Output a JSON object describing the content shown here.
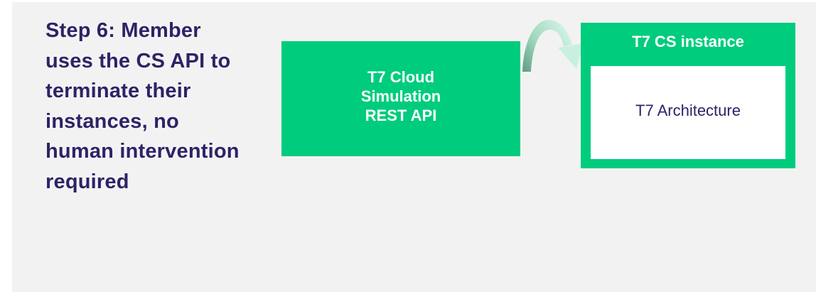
{
  "step": {
    "text": "Step 6: Member uses the CS API to terminate their instances, no human intervention required"
  },
  "api_box": {
    "label_line1": "T7 Cloud",
    "label_line2": "Simulation",
    "label_line3": "REST API"
  },
  "cs_instance": {
    "title": "T7 CS instance",
    "inner_label": "T7 Architecture"
  },
  "colors": {
    "background_panel": "#f3f2f3",
    "brand_green": "#00cc7e",
    "text_navy": "#2d2366",
    "arrow_light": "#c9f0de",
    "arrow_dark": "#5f9c80"
  },
  "icons": {
    "connector": "curved-arrow-icon"
  }
}
